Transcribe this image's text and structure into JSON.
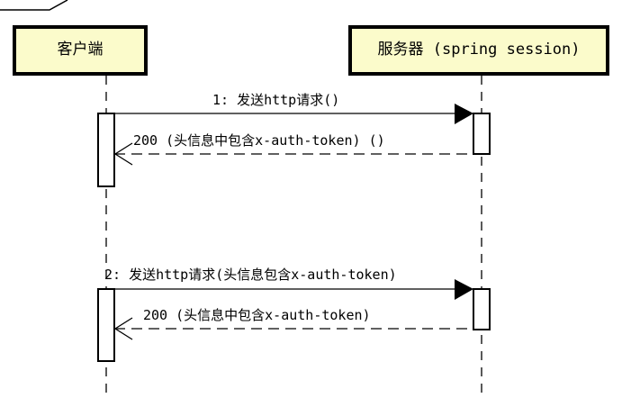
{
  "diagram": {
    "type": "sequence",
    "actors": [
      {
        "name": "客户端"
      },
      {
        "name": "服务器 (spring session)"
      }
    ],
    "messages": [
      {
        "label": "1: 发送http请求()",
        "from": "客户端",
        "to": "服务器 (spring session)",
        "kind": "sync"
      },
      {
        "label": "200 (头信息中包含x-auth-token) ()",
        "from": "服务器 (spring session)",
        "to": "客户端",
        "kind": "return"
      },
      {
        "label": "2: 发送http请求(头信息包含x-auth-token)",
        "from": "客户端",
        "to": "服务器 (spring session)",
        "kind": "sync"
      },
      {
        "label": "200 (头信息中包含x-auth-token)",
        "from": "服务器 (spring session)",
        "to": "客户端",
        "kind": "return"
      }
    ],
    "colors": {
      "actor_fill": "#fbfbcb",
      "line": "#000000"
    }
  }
}
